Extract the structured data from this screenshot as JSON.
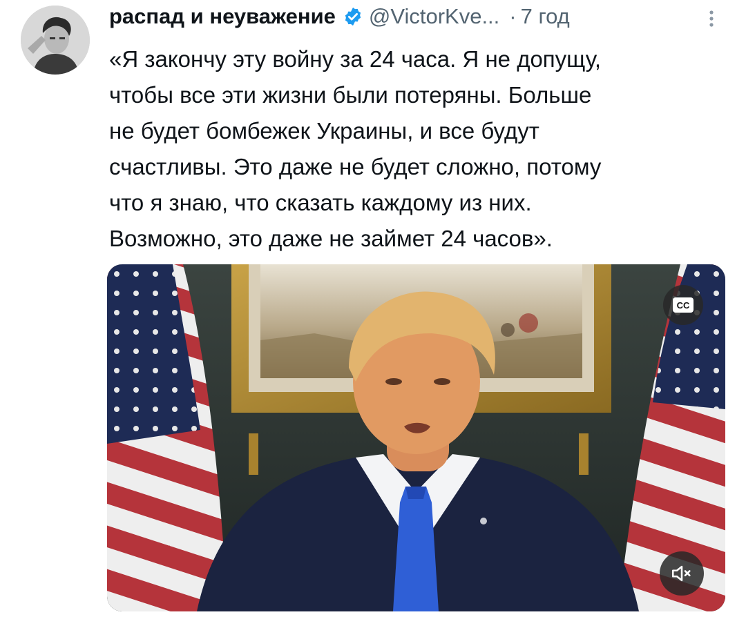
{
  "tweet": {
    "display_name": "распад и неуважение",
    "handle": "@VictorKve...",
    "separator": "·",
    "time": "7 год",
    "text_lines": [
      "«Я закончу эту войну за 24 часа. Я не допущу,",
      "чтобы все эти жизни были потеряны. Больше",
      "не будет бомбежек Украины, и все будут",
      "счастливы. Это даже не будет сложно, потому",
      "что я знаю, что сказать каждому из них.",
      "Возможно, это даже не займет 24 часов»."
    ]
  },
  "video": {
    "cc_label": "CC"
  },
  "icons": {
    "verified": "verified-badge-icon",
    "more": "more-options-icon",
    "captions": "closed-captions-icon",
    "mute": "volume-muted-icon"
  },
  "colors": {
    "text": "#0f1419",
    "secondary": "#536471",
    "verified": "#1d9bf0",
    "control_bg": "#282828"
  }
}
